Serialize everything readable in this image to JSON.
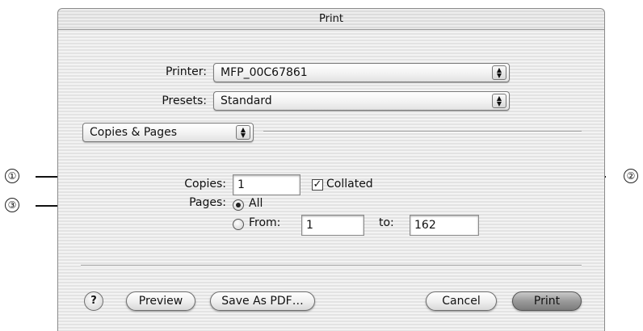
{
  "window": {
    "title": "Print"
  },
  "printer": {
    "label": "Printer:",
    "value": "MFP_00C67861"
  },
  "presets": {
    "label": "Presets:",
    "value": "Standard"
  },
  "panel": {
    "value": "Copies & Pages"
  },
  "copies": {
    "label": "Copies:",
    "value": "1",
    "collated_label": "Collated",
    "collated_checked": true
  },
  "pages": {
    "label": "Pages:",
    "all_label": "All",
    "from_label": "From:",
    "from_value": "1",
    "to_label": "to:",
    "to_value": "162",
    "selected": "All"
  },
  "buttons": {
    "help": "?",
    "preview": "Preview",
    "save_pdf": "Save As PDF…",
    "cancel": "Cancel",
    "print": "Print"
  },
  "callouts": [
    "①",
    "②",
    "③"
  ],
  "icons": {
    "popup": "updown-arrows-icon",
    "check": "checkmark-icon"
  }
}
